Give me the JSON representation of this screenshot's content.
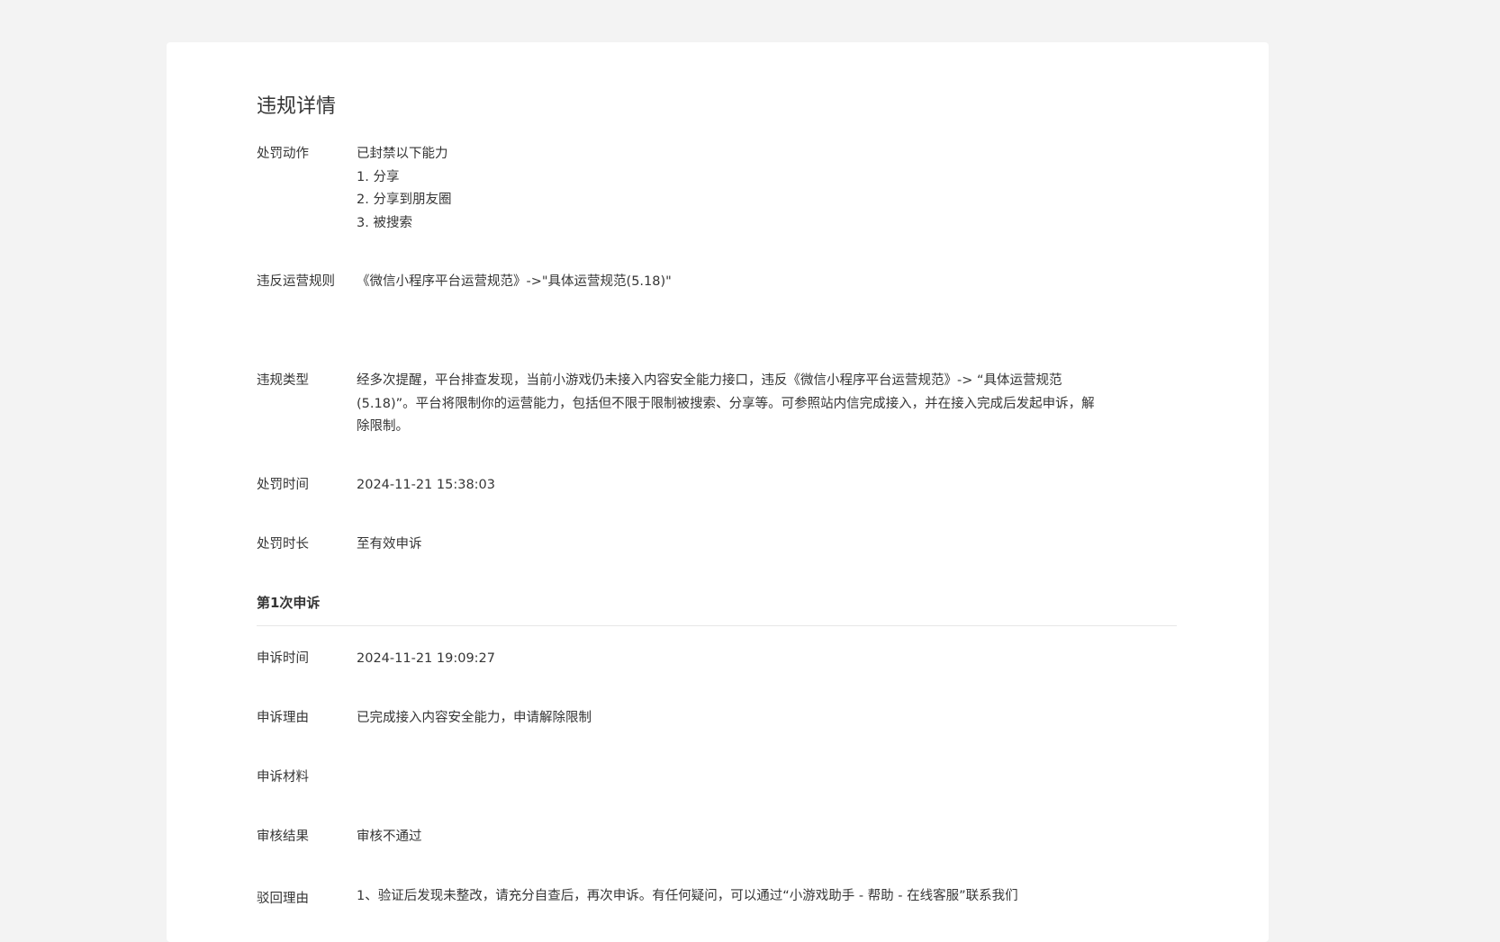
{
  "page": {
    "title": "违规详情"
  },
  "penalty_action": {
    "label": "处罚动作",
    "lines": [
      "已封禁以下能力",
      "1. 分享",
      "2. 分享到朋友圈",
      "3. 被搜索"
    ]
  },
  "violated_rule": {
    "label": "违反运营规则",
    "link": "《微信小程序平台运营规范》->\"具体运营规范(5.18)\""
  },
  "violation_type": {
    "label": "违规类型",
    "lines": [
      "经多次提醒，平台排查发现，当前小游戏仍未接入内容安全能力接口，违反《微信小程序平台运营规范》-> “具体运营规范",
      "(5.18)”。平台将限制你的运营能力，包括但不限于限制被搜索、分享等。可参照站内信完成接入，并在接入完成后发起申诉，解",
      "除限制。"
    ]
  },
  "penalty_time": {
    "label": "处罚时间",
    "value": "2024-11-21 15:38:03"
  },
  "penalty_duration": {
    "label": "处罚时长",
    "value": "至有效申诉"
  },
  "appeal": {
    "section_title": "第1次申诉",
    "time": {
      "label": "申诉时间",
      "value": "2024-11-21 19:09:27"
    },
    "reason": {
      "label": "申诉理由",
      "value": "已完成接入内容安全能力，申请解除限制"
    },
    "materials": {
      "label": "申诉材料",
      "value": ""
    },
    "result": {
      "label": "审核结果",
      "value": "审核不通过"
    },
    "reject_reason": {
      "label": "驳回理由",
      "value": "1、验证后发现未整改，请充分自查后，再次申诉。有任何疑问，可以通过“小游戏助手 - 帮助 - 在线客服”联系我们"
    }
  }
}
